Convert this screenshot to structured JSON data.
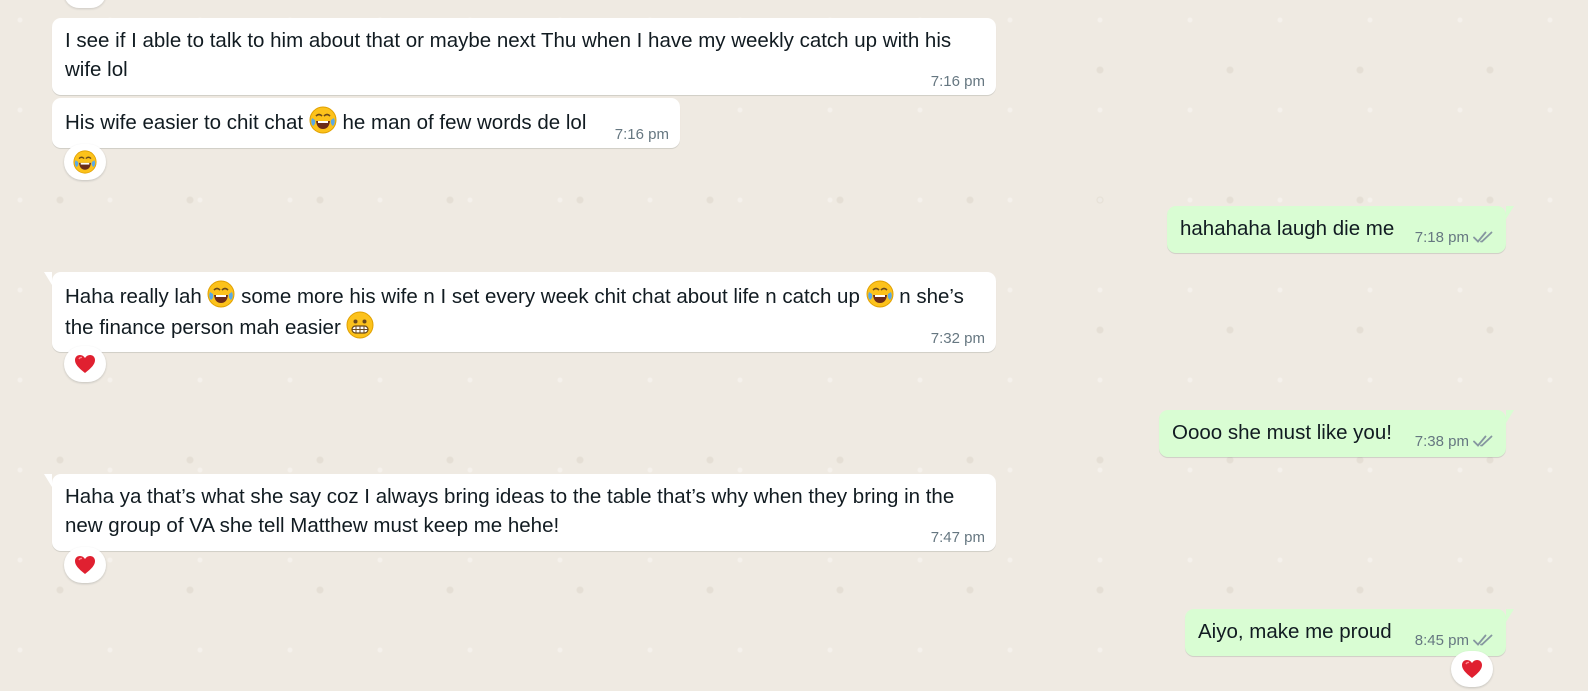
{
  "messages": [
    {
      "direction": "incoming",
      "text": "I see if I able to talk to him about that or maybe next Thu when I have my weekly catch up with his wife lol",
      "time": "7:16 pm"
    },
    {
      "direction": "incoming",
      "text_parts": [
        "His wife easier to chit chat ",
        " he man of few words de lol"
      ],
      "emojis": [
        "tears-of-joy-emoji"
      ],
      "time": "7:16 pm",
      "reaction": "tears-of-joy-emoji"
    },
    {
      "direction": "outgoing",
      "text": "hahahaha laugh die me",
      "time": "7:18 pm",
      "status": "read-double-check"
    },
    {
      "direction": "incoming",
      "text_parts": [
        "Haha really lah ",
        " some more his wife n I set every week chit chat about life n catch up ",
        " n she’s the finance person mah easier "
      ],
      "emojis": [
        "tears-of-joy-emoji",
        "tears-of-joy-emoji",
        "grimacing-face-emoji"
      ],
      "time": "7:32 pm",
      "reaction": "red-heart-emoji"
    },
    {
      "direction": "outgoing",
      "text": "Oooo she must like you!",
      "time": "7:38 pm",
      "status": "read-double-check"
    },
    {
      "direction": "incoming",
      "text": "Haha ya that’s what she say coz I always bring ideas to the table that’s why when they bring in the new group of VA she tell Matthew must keep me hehe!",
      "time": "7:47 pm",
      "reaction": "red-heart-emoji"
    },
    {
      "direction": "outgoing",
      "text": "Aiyo, make me proud",
      "time": "8:45 pm",
      "status": "read-double-check",
      "reaction": "red-heart-emoji"
    }
  ],
  "colors": {
    "wallpaper": "#efeae2",
    "incoming_bubble": "#ffffff",
    "outgoing_bubble": "#d9fdd3",
    "text": "#111b21",
    "meta": "#667781",
    "read_ticks": "#667781"
  }
}
